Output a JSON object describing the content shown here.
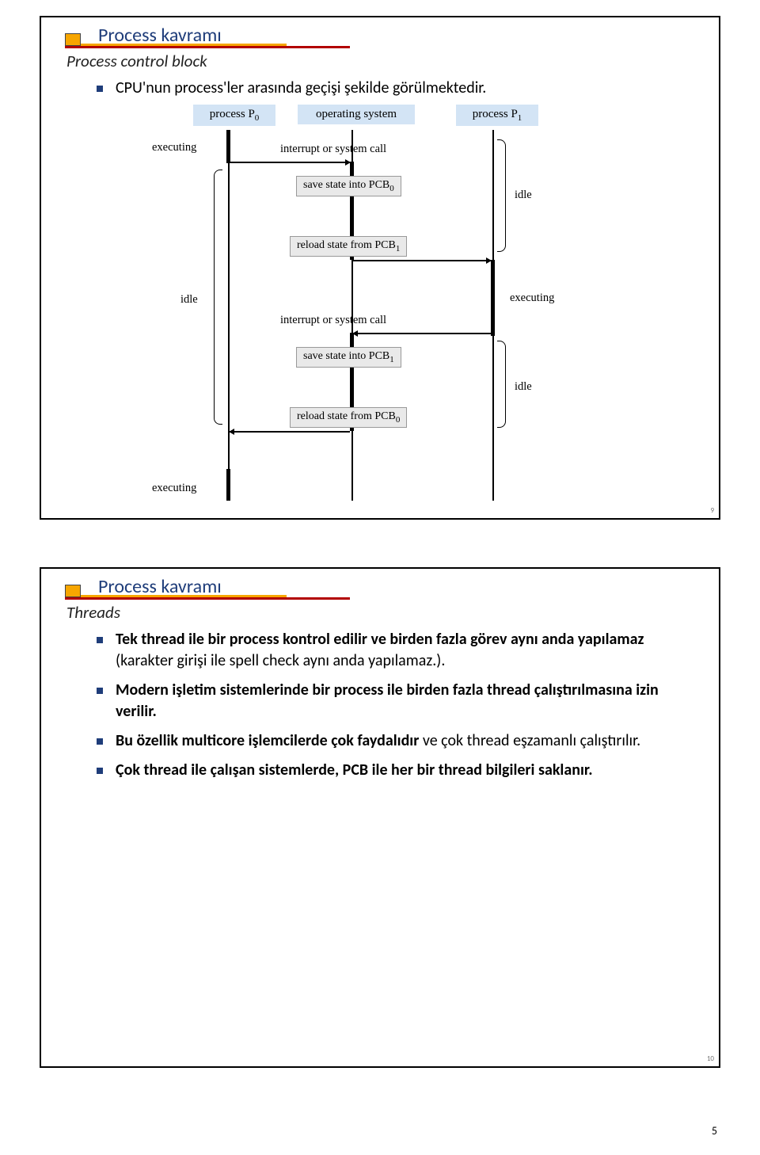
{
  "page_number": "5",
  "slide1": {
    "number": "9",
    "title": "Process kavramı",
    "subtitle": "Process control block",
    "bullets": [
      "CPU'nun process'ler arasında geçişi şekilde görülmektedir."
    ],
    "diagram": {
      "col0": "process P",
      "col0_sub": "0",
      "col1": "operating system",
      "col2": "process P",
      "col2_sub": "1",
      "interrupt": "interrupt or system call",
      "save0": "save state into PCB",
      "save0_sub": "0",
      "reload1": "reload state from PCB",
      "reload1_sub": "1",
      "save1": "save state into PCB",
      "save1_sub": "1",
      "reload0": "reload state from PCB",
      "reload0_sub": "0",
      "executing": "executing",
      "idle": "idle"
    }
  },
  "slide2": {
    "number": "10",
    "title": "Process kavramı",
    "subtitle": "Threads",
    "bullets": [
      {
        "pre": "Tek thread ile bir process kontrol edilir ve birden fazla görev aynı anda yapılamaz",
        "post": " (karakter girişi ile spell check aynı anda yapılamaz.)."
      },
      {
        "pre": "Modern işletim sistemlerinde bir process ile birden fazla thread çalıştırılmasına izin verilir.",
        "post": ""
      },
      {
        "pre": "Bu özellik multicore işlemcilerde çok faydalıdır",
        "post": " ve çok thread eşzamanlı çalıştırılır."
      },
      {
        "pre": "Çok thread ile çalışan sistemlerde, PCB ile her bir thread bilgileri saklanır.",
        "post": ""
      }
    ]
  }
}
